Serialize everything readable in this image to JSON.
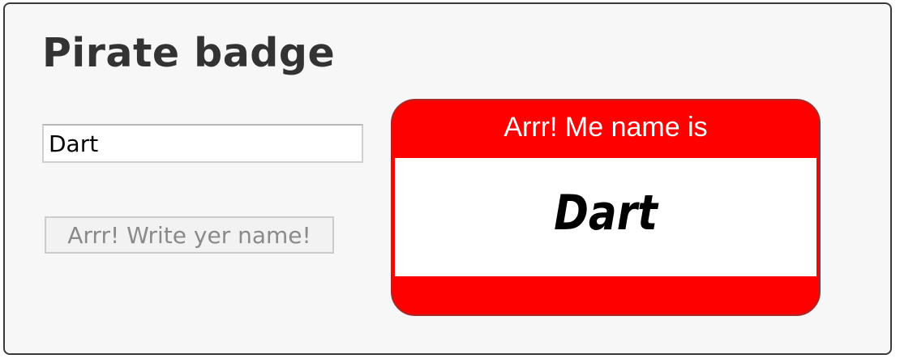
{
  "app": {
    "title": "Pirate badge"
  },
  "form": {
    "name_input_value": "Dart",
    "button_label": "Arrr! Write yer name!"
  },
  "badge": {
    "header_text": "Arrr! Me name is",
    "name_text": "Dart"
  },
  "colors": {
    "badge_red": "#ff0000",
    "badge_border": "#a52a2a",
    "panel_background": "#f7f7f7",
    "title_text": "#333333"
  }
}
